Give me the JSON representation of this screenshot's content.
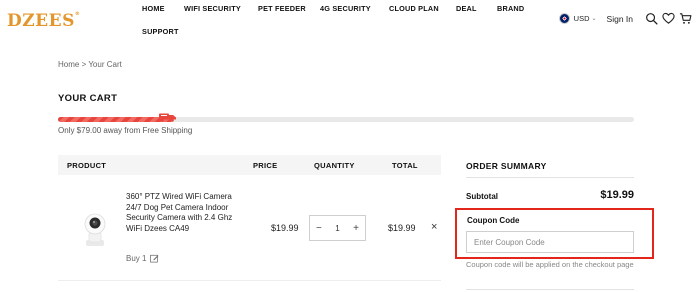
{
  "header": {
    "logo": "DZEES",
    "logo_mark": "®",
    "nav": [
      {
        "label": "HOME"
      },
      {
        "label": "WIFI SECURITY"
      },
      {
        "label": "PET FEEDER"
      },
      {
        "label": "4G SECURITY"
      },
      {
        "label": "CLOUD PLAN"
      },
      {
        "label": "DEAL"
      },
      {
        "label": "BRAND"
      },
      {
        "label": "SUPPORT"
      }
    ],
    "currency": "USD",
    "signin": "Sign In",
    "icons": [
      "uk-flag-icon",
      "search-icon",
      "heart-icon",
      "cart-icon"
    ]
  },
  "breadcrumb": {
    "home": "Home",
    "sep": ">",
    "current": "Your Cart"
  },
  "page_title": "YOUR CART",
  "shipping": {
    "progress_percent": 20,
    "progress_label": "20%",
    "message": "Only $79.00 away from Free Shipping",
    "fill_color": "#e8453c"
  },
  "table": {
    "headers": {
      "product": "PRODUCT",
      "price": "PRICE",
      "quantity": "QUANTITY",
      "total": "TOTAL"
    }
  },
  "cart_item": {
    "title": "360° PTZ Wired WiFi Camera 24/7 Dog Pet Camera Indoor Security Camera with 2.4 Ghz WiFi Dzees CA49",
    "buy_label": "Buy 1",
    "price": "$19.99",
    "quantity": "1",
    "minus": "−",
    "plus": "+",
    "total": "$19.99",
    "remove": "×"
  },
  "summary": {
    "title": "ORDER SUMMARY",
    "subtotal_label": "Subtotal",
    "subtotal_value": "$19.99",
    "coupon_label": "Coupon Code",
    "coupon_placeholder": "Enter Coupon Code",
    "coupon_note": "Coupon code will be applied on the checkout page",
    "highlight_color": "#e3261c"
  }
}
